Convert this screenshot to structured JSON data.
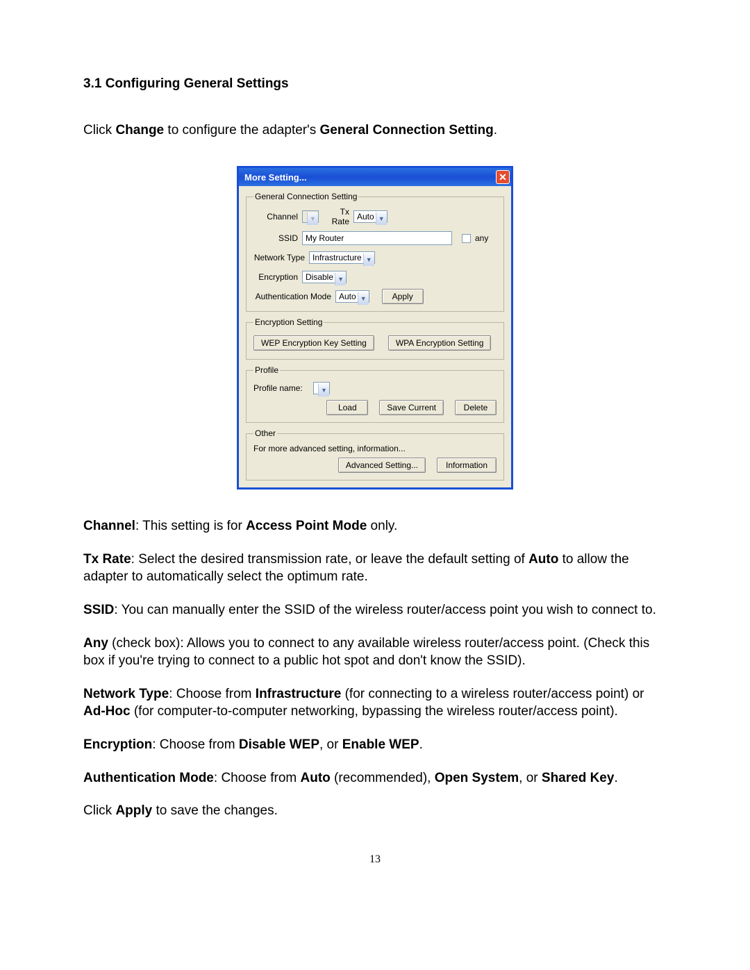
{
  "heading": "3.1 Configuring General Settings",
  "intro_parts": {
    "p1": "Click ",
    "b1": "Change",
    "p2": " to configure the adapter's ",
    "b2": "General Connection Setting",
    "p3": "."
  },
  "dialog": {
    "title": "More Setting...",
    "close": "✕",
    "general": {
      "legend": "General Connection Setting",
      "channel_label": "Channel",
      "channel_value": "",
      "txrate_label": "Tx Rate",
      "txrate_value": "Auto",
      "ssid_label": "SSID",
      "ssid_value": "My Router",
      "any_label": "any",
      "nettype_label": "Network Type",
      "nettype_value": "Infrastructure",
      "encryption_label": "Encryption",
      "encryption_value": "Disable",
      "auth_label": "Authentication Mode",
      "auth_value": "Auto",
      "apply": "Apply"
    },
    "encryption": {
      "legend": "Encryption Setting",
      "wep": "WEP Encryption Key Setting",
      "wpa": "WPA Encryption Setting"
    },
    "profile": {
      "legend": "Profile",
      "name_label": "Profile name:",
      "name_value": "",
      "load": "Load",
      "save": "Save Current",
      "delete": "Delete"
    },
    "other": {
      "legend": "Other",
      "text": "For more advanced setting, information...",
      "advanced": "Advanced Setting...",
      "info": "Information"
    }
  },
  "desc": {
    "channel": {
      "b1": "Channel",
      "p1": ": This setting is for ",
      "b2": "Access Point Mode",
      "p2": " only."
    },
    "txrate": {
      "b1": "Tx Rate",
      "p1": ": Select the desired transmission rate, or leave the default setting of ",
      "b2": "Auto",
      "p2": " to allow the adapter to automatically select the optimum rate."
    },
    "ssid": {
      "b1": "SSID",
      "p1": ": You can manually enter the SSID of the wireless router/access point you wish to connect to."
    },
    "any": {
      "b1": "Any",
      "p1": " (check box): Allows you to connect to any available wireless router/access point. (Check this box if you're trying to connect to a public hot spot and don't know the SSID)."
    },
    "nettype": {
      "b1": "Network Type",
      "p1": ": Choose from ",
      "b2": "Infrastructure",
      "p2": " (for connecting to a wireless router/access point) or ",
      "b3": "Ad-Hoc",
      "p3": " (for computer-to-computer networking, bypassing the wireless router/access point)."
    },
    "encryption": {
      "b1": "Encryption",
      "p1": ": Choose from ",
      "b2": "Disable WEP",
      "p2": ", or ",
      "b3": "Enable WEP",
      "p3": "."
    },
    "auth": {
      "b1": "Authentication Mode",
      "p1": ": Choose from ",
      "b2": "Auto",
      "p2": " (recommended), ",
      "b3": "Open System",
      "p3": ", or ",
      "b4": "Shared Key",
      "p4": "."
    },
    "apply": {
      "p1": "Click ",
      "b1": "Apply",
      "p2": " to save the changes."
    }
  },
  "page_number": "13"
}
